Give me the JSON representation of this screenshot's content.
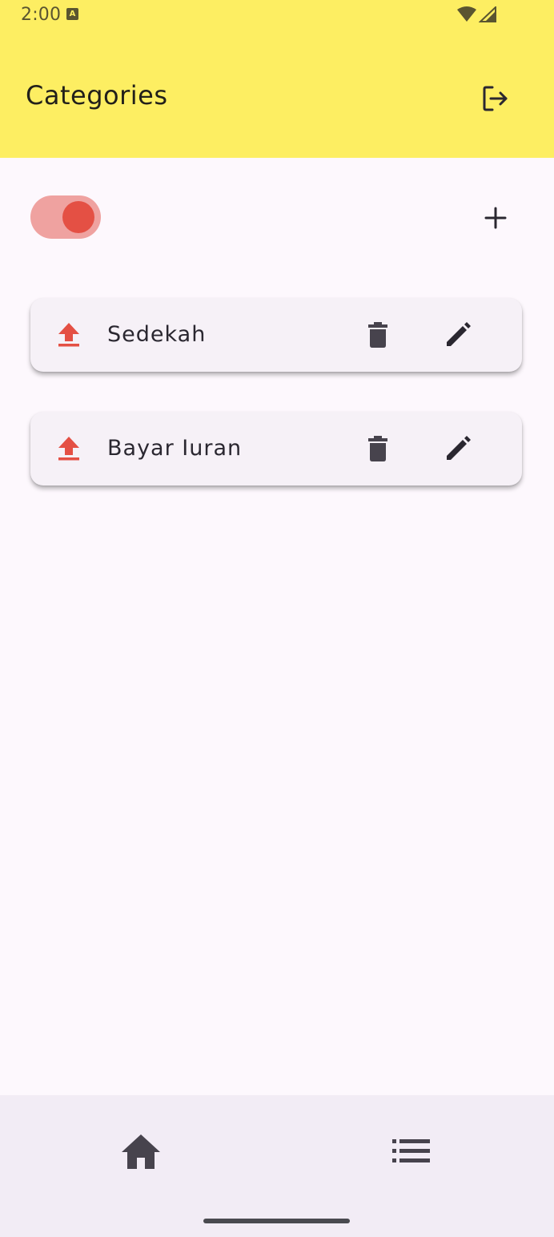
{
  "status_bar": {
    "time": "2:00"
  },
  "app_bar": {
    "title": "Categories"
  },
  "toggle": {
    "state": "on",
    "track_color": "#efa2a0",
    "thumb_color": "#e45044"
  },
  "categories": [
    {
      "name": "Sedekah",
      "icon": "upload-icon"
    },
    {
      "name": "Bayar Iuran",
      "icon": "upload-icon"
    }
  ],
  "bottom_nav": {
    "items": [
      {
        "icon": "home-icon"
      },
      {
        "icon": "list-icon"
      }
    ]
  },
  "colors": {
    "app_bar": "#fdee62",
    "accent": "#e45044",
    "background": "#fdf8fd",
    "card": "#f6f1f7",
    "bottom_nav": "#f2ecf5"
  }
}
